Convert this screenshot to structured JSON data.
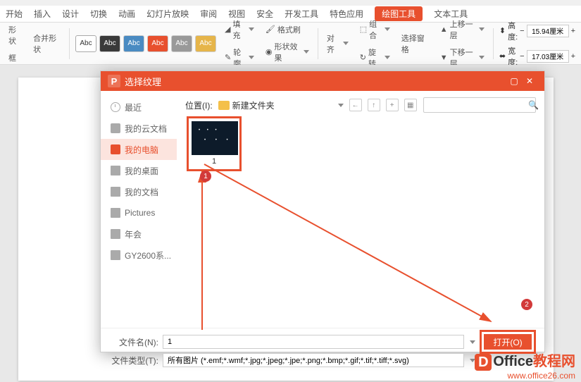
{
  "ribbon": {
    "tabs": [
      "开始",
      "插入",
      "设计",
      "切换",
      "动画",
      "幻灯片放映",
      "审阅",
      "视图",
      "安全",
      "开发工具",
      "特色应用",
      "绘图工具",
      "文本工具"
    ],
    "active_tab": "绘图工具",
    "group_left_1": "形状",
    "group_left_2": "框",
    "group_left_3": "合并形状",
    "swatch_label": "Abc",
    "fill": "填充",
    "outline": "轮廓",
    "format_painter": "格式刷",
    "shape_effect": "形状效果",
    "align": "对齐",
    "rotate": "旋转",
    "combine": "组合",
    "select_pane": "选择窗格",
    "move_up": "上移一层",
    "move_down": "下移一层",
    "height_label": "高度:",
    "width_label": "宽度:",
    "height_value": "15.94厘米",
    "width_value": "17.03厘米"
  },
  "dialog": {
    "title": "选择纹理",
    "sidebar": {
      "recent": "最近",
      "my_cloud": "我的云文档",
      "my_computer": "我的电脑",
      "my_desktop": "我的桌面",
      "my_docs": "我的文档",
      "pictures": "Pictures",
      "yearhui": "年会",
      "gy": "GY2600系..."
    },
    "location_label": "位置(I):",
    "location_value": "新建文件夹",
    "thumb_name": "1",
    "filename_label": "文件名(N):",
    "filename_value": "1",
    "filetype_label": "文件类型(T):",
    "filetype_value": "所有图片 (*.emf;*.wmf;*.jpg;*.jpeg;*.jpe;*.png;*.bmp;*.gif;*.tif;*.tiff;*.svg)",
    "open_btn": "打开(O)",
    "callout_1": "1",
    "callout_2": "2"
  },
  "watermark": {
    "icon": "D",
    "office": "Office",
    "course": "教程网",
    "url": "www.office26.com"
  }
}
